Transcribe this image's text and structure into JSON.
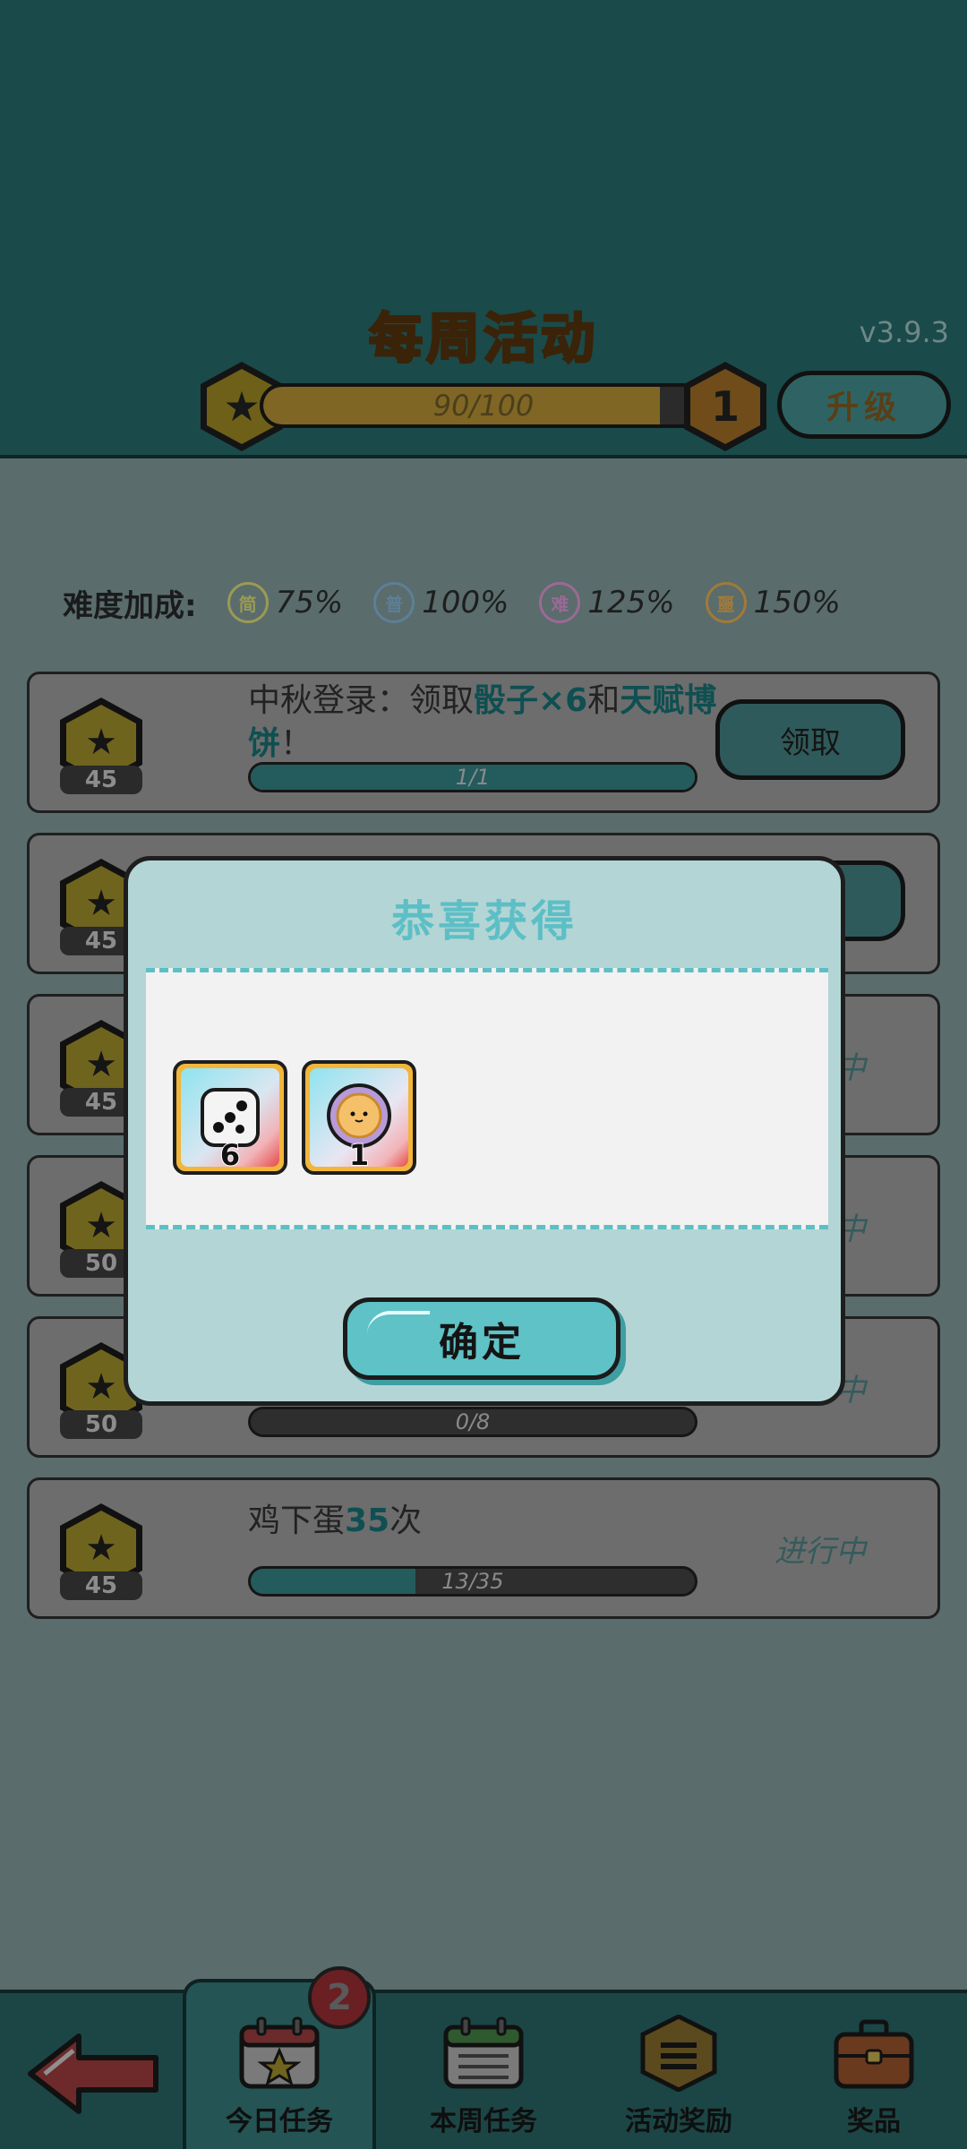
{
  "header": {
    "title": "每周活动",
    "version": "v3.9.3",
    "progress_text": "90/100",
    "progress_fraction": 0.9,
    "level": "1",
    "upgrade_label": "升级"
  },
  "difficulty": {
    "label": "难度加成:",
    "items": [
      {
        "icon_text": "简",
        "value": "75%",
        "color": "#9a9a55"
      },
      {
        "icon_text": "普",
        "value": "100%",
        "color": "#5d7f97"
      },
      {
        "icon_text": "难",
        "value": "125%",
        "color": "#9a6a95"
      },
      {
        "icon_text": "噩",
        "value": "150%",
        "color": "#a07a3a"
      }
    ]
  },
  "tasks": [
    {
      "reward": "45",
      "title_parts": [
        "中秋登录：领取",
        "骰子×6",
        "和",
        "天赋博",
        "饼",
        "！"
      ],
      "progress_text": "1/1",
      "progress": 1.0,
      "action": "领取"
    },
    {
      "reward": "45"
    },
    {
      "reward": "45",
      "status": "中"
    },
    {
      "reward": "50",
      "status": "中"
    },
    {
      "reward": "50",
      "status": "中",
      "progress_text": "0/8",
      "progress": 0.0
    },
    {
      "reward": "45",
      "title_parts": [
        "鸡下蛋",
        "35",
        "次"
      ],
      "progress_text": "13/35",
      "progress": 0.37,
      "status": "进行中"
    }
  ],
  "modal": {
    "title": "恭喜获得",
    "items": [
      {
        "name": "dice-icon",
        "qty": "6"
      },
      {
        "name": "mooncake-icon",
        "qty": "1"
      }
    ],
    "confirm_label": "确定"
  },
  "nav": {
    "tabs": [
      {
        "label": "今日任务",
        "active": true,
        "badge": "2"
      },
      {
        "label": "本周任务"
      },
      {
        "label": "活动奖励"
      },
      {
        "label": "奖品"
      }
    ]
  },
  "colors": {
    "header_bg": "#1b4a4a",
    "accent_teal": "#5ec2c6",
    "title_gold": "#d9a135",
    "overlay_bg": "#5a6c6c"
  }
}
